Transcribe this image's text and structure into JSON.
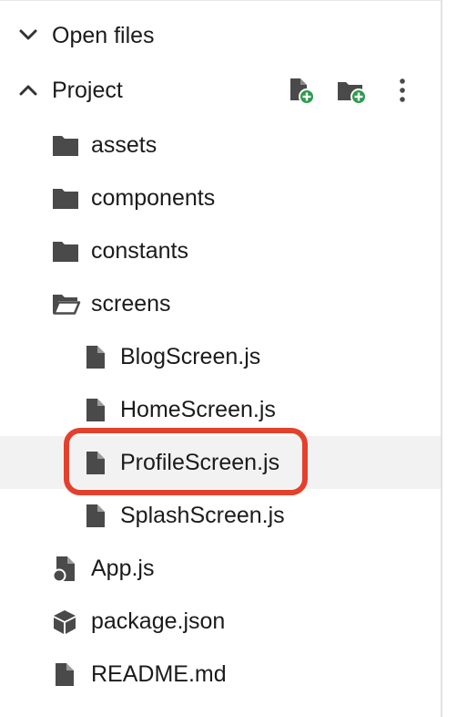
{
  "sections": {
    "open_files": {
      "label": "Open files",
      "expanded": false
    },
    "project": {
      "label": "Project",
      "expanded": true,
      "actions": [
        {
          "name": "new-file",
          "icon": "file-plus-icon"
        },
        {
          "name": "new-folder",
          "icon": "folder-plus-icon"
        },
        {
          "name": "more",
          "icon": "more-vertical-icon"
        }
      ]
    }
  },
  "tree": [
    {
      "label": "assets",
      "type": "folder",
      "icon": "folder-icon"
    },
    {
      "label": "components",
      "type": "folder",
      "icon": "folder-icon"
    },
    {
      "label": "constants",
      "type": "folder",
      "icon": "folder-icon"
    },
    {
      "label": "screens",
      "type": "folder",
      "icon": "folder-open-icon",
      "expanded": true,
      "children": [
        {
          "label": "BlogScreen.js",
          "icon": "file-icon"
        },
        {
          "label": "HomeScreen.js",
          "icon": "file-icon"
        },
        {
          "label": "ProfileScreen.js",
          "icon": "file-icon",
          "selected": true,
          "highlighted": true
        },
        {
          "label": "SplashScreen.js",
          "icon": "file-icon"
        }
      ]
    },
    {
      "label": "App.js",
      "type": "file",
      "icon": "file-entry-icon"
    },
    {
      "label": "package.json",
      "type": "file",
      "icon": "package-icon"
    },
    {
      "label": "README.md",
      "type": "file",
      "icon": "file-icon"
    }
  ],
  "colors": {
    "icon": "#4a4a4a",
    "add_badge": "#2e9b4e",
    "highlight": "#e4402c",
    "selected_row": "#f2f2f2"
  }
}
